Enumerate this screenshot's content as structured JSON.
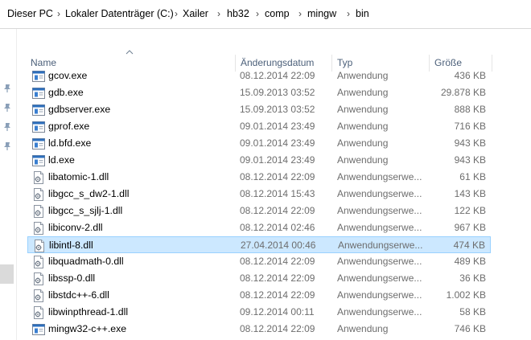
{
  "breadcrumb": [
    "Dieser PC",
    "Lokaler Datenträger (C:)",
    "Xailer",
    "hb32",
    "comp",
    "mingw",
    "bin"
  ],
  "columns": {
    "name": "Name",
    "date": "Änderungsdatum",
    "type": "Typ",
    "size": "Größe"
  },
  "sort": {
    "column": "name",
    "direction": "ascending"
  },
  "files": [
    {
      "name": "gcov.exe",
      "date": "08.12.2014 22:09",
      "type": "Anwendung",
      "size": "436 KB",
      "icon": "exe-icon"
    },
    {
      "name": "gdb.exe",
      "date": "15.09.2013 03:52",
      "type": "Anwendung",
      "size": "29.878 KB",
      "icon": "exe-icon"
    },
    {
      "name": "gdbserver.exe",
      "date": "15.09.2013 03:52",
      "type": "Anwendung",
      "size": "888 KB",
      "icon": "exe-icon"
    },
    {
      "name": "gprof.exe",
      "date": "09.01.2014 23:49",
      "type": "Anwendung",
      "size": "716 KB",
      "icon": "exe-icon"
    },
    {
      "name": "ld.bfd.exe",
      "date": "09.01.2014 23:49",
      "type": "Anwendung",
      "size": "943 KB",
      "icon": "exe-icon"
    },
    {
      "name": "ld.exe",
      "date": "09.01.2014 23:49",
      "type": "Anwendung",
      "size": "943 KB",
      "icon": "exe-icon"
    },
    {
      "name": "libatomic-1.dll",
      "date": "08.12.2014 22:09",
      "type": "Anwendungserwe...",
      "size": "61 KB",
      "icon": "dll-icon"
    },
    {
      "name": "libgcc_s_dw2-1.dll",
      "date": "08.12.2014 15:43",
      "type": "Anwendungserwe...",
      "size": "143 KB",
      "icon": "dll-icon"
    },
    {
      "name": "libgcc_s_sjlj-1.dll",
      "date": "08.12.2014 22:09",
      "type": "Anwendungserwe...",
      "size": "122 KB",
      "icon": "dll-icon"
    },
    {
      "name": "libiconv-2.dll",
      "date": "08.12.2014 02:46",
      "type": "Anwendungserwe...",
      "size": "967 KB",
      "icon": "dll-icon"
    },
    {
      "name": "libintl-8.dll",
      "date": "27.04.2014 00:46",
      "type": "Anwendungserwe...",
      "size": "474 KB",
      "icon": "dll-icon",
      "selected": true
    },
    {
      "name": "libquadmath-0.dll",
      "date": "08.12.2014 22:09",
      "type": "Anwendungserwe...",
      "size": "489 KB",
      "icon": "dll-icon"
    },
    {
      "name": "libssp-0.dll",
      "date": "08.12.2014 22:09",
      "type": "Anwendungserwe...",
      "size": "36 KB",
      "icon": "dll-icon"
    },
    {
      "name": "libstdc++-6.dll",
      "date": "08.12.2014 22:09",
      "type": "Anwendungserwe...",
      "size": "1.002 KB",
      "icon": "dll-icon"
    },
    {
      "name": "libwinpthread-1.dll",
      "date": "09.12.2014 00:11",
      "type": "Anwendungserwe...",
      "size": "58 KB",
      "icon": "dll-icon"
    },
    {
      "name": "mingw32-c++.exe",
      "date": "08.12.2014 22:09",
      "type": "Anwendung",
      "size": "746 KB",
      "icon": "exe-icon"
    }
  ],
  "colors": {
    "selection_bg": "#cce8ff",
    "selection_border": "#99d1ff",
    "header_text": "#4c607a",
    "meta_text": "#6d6d6d"
  }
}
